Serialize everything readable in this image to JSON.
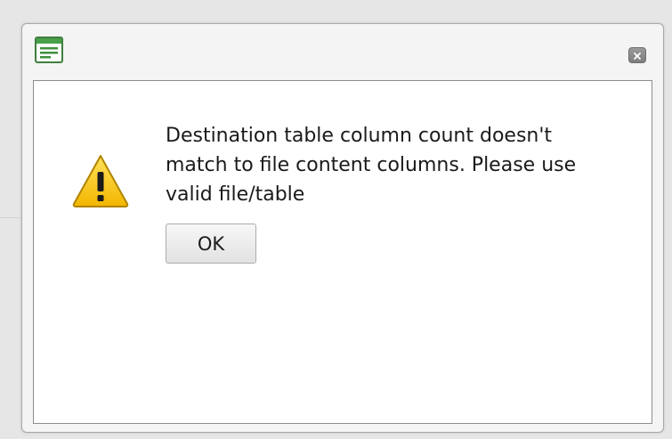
{
  "dialog": {
    "app_icon": "window-form-icon",
    "close_icon": "close-icon",
    "warning_icon": "warning-triangle-icon",
    "message_lines": [
      "Destination table column count doesn't",
      "match to file content columns. Please use",
      "valid file/table"
    ],
    "ok_label": "OK"
  },
  "colors": {
    "icon_green": "#3f9a3f",
    "warning_yellow": "#f5c400",
    "close_gray": "#8a8a8a"
  }
}
